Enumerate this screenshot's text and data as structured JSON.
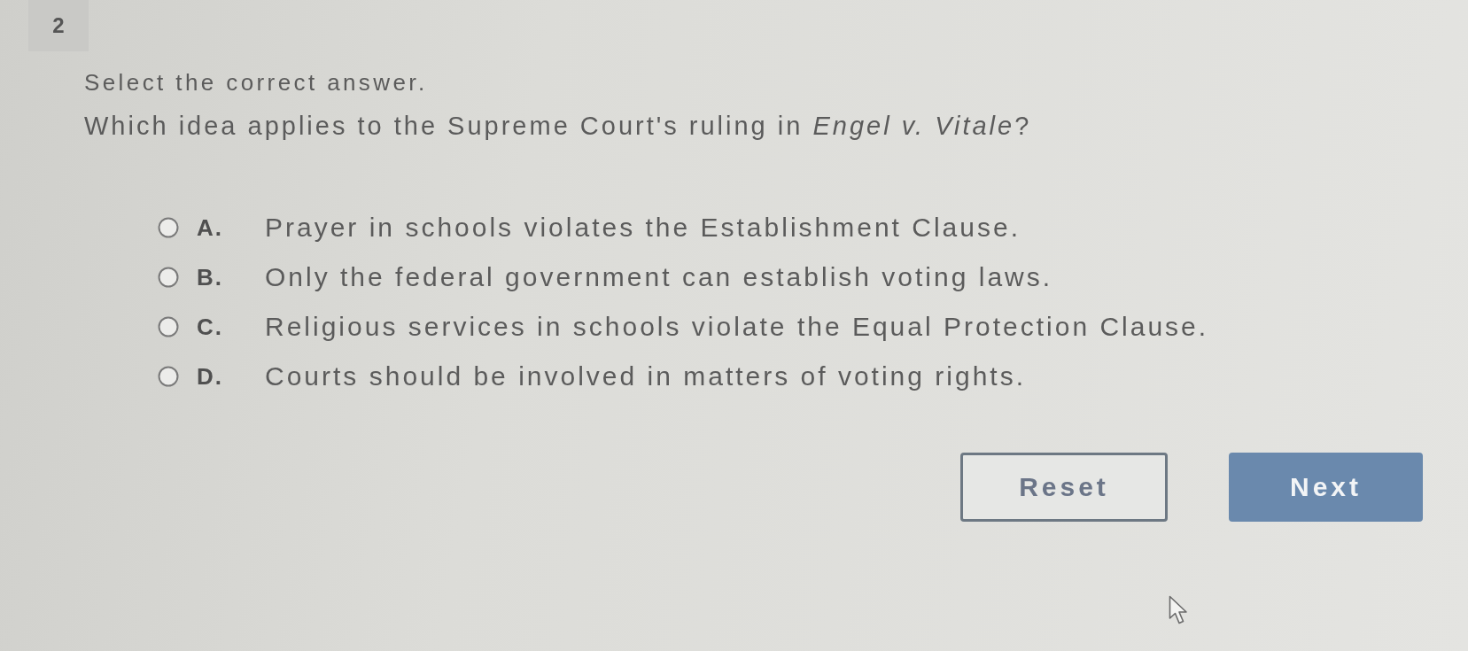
{
  "question_number": "2",
  "instruction": "Select the correct answer.",
  "question": "Which idea applies to the Supreme Court's ruling in *Engel v. Vitale*?",
  "options": [
    {
      "letter": "A.",
      "text": "Prayer in schools violates the Establishment Clause.",
      "selected": false
    },
    {
      "letter": "B.",
      "text": "Only the federal government can establish voting laws.",
      "selected": false
    },
    {
      "letter": "C.",
      "text": "Religious services in schools violate the Equal Protection Clause.",
      "selected": false
    },
    {
      "letter": "D.",
      "text": "Courts should be involved in matters of voting rights.",
      "selected": false
    }
  ],
  "buttons": [
    {
      "kind": "outline",
      "label": "Reset"
    },
    {
      "kind": "primary",
      "label": "Next"
    }
  ]
}
